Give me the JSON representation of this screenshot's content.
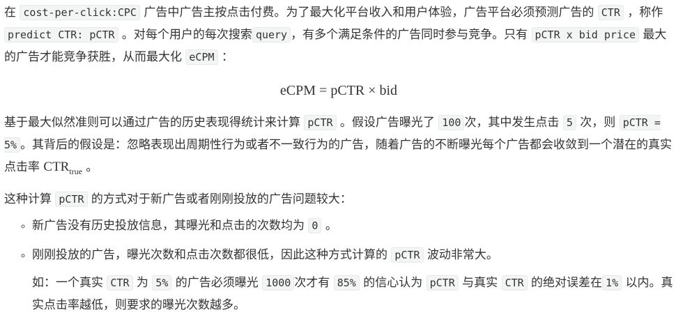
{
  "paragraphs": [
    {
      "id": "intro",
      "segments": [
        {
          "t": "在 "
        },
        {
          "c": "cost-per-click:CPC"
        },
        {
          "t": " 广告中广告主按点击付费。为了最大化平台收入和用户体验，广告平台必须预测广告的 "
        },
        {
          "c": "CTR"
        },
        {
          "t": " ，称作 "
        },
        {
          "c": "predict CTR: pCTR"
        },
        {
          "t": " 。对每个用户的每次搜索"
        },
        {
          "c": "query"
        },
        {
          "t": "，有多个满足条件的广告同时参与竞争。只有 "
        },
        {
          "c": "pCTR x bid price"
        },
        {
          "t": " 最大的广告才能竞争获胜，从而最大化 "
        },
        {
          "c": "eCPM"
        },
        {
          "t": " ："
        }
      ]
    },
    {
      "id": "estimate",
      "segments": [
        {
          "t": "基于最大似然准则可以通过广告的历史表现得统计来计算 "
        },
        {
          "c": "pCTR"
        },
        {
          "t": " 。假设广告曝光了 "
        },
        {
          "c": "100"
        },
        {
          "t": "次，其中发生点击 "
        },
        {
          "c": "5"
        },
        {
          "t": " 次，则 "
        },
        {
          "c": "pCTR = 5%"
        },
        {
          "t": "。其背后的假设是：忽略表现出周期性行为或者不一致行为的广告，随着广告的不断曝光每个广告都会收敛到一个潜在的真实点击率 "
        },
        {
          "m": "CTR",
          "sub": "true"
        },
        {
          "t": " 。"
        }
      ]
    },
    {
      "id": "problem",
      "segments": [
        {
          "t": "这种计算 "
        },
        {
          "c": "pCTR"
        },
        {
          "t": " 的方式对于新广告或者刚刚投放的广告问题较大："
        }
      ]
    }
  ],
  "formula": "eCPM = pCTR × bid",
  "list": [
    {
      "segments": [
        {
          "t": "新广告没有历史投放信息，其曝光和点击的次数均为 "
        },
        {
          "c": "0"
        },
        {
          "t": " 。"
        }
      ]
    },
    {
      "segments": [
        {
          "t": "刚刚投放的广告，曝光次数和点击次数都很低，因此这种方式计算的 "
        },
        {
          "c": "pCTR"
        },
        {
          "t": " 波动非常大。"
        }
      ]
    }
  ],
  "example": {
    "segments": [
      {
        "t": "如：一个真实 "
      },
      {
        "c": "CTR"
      },
      {
        "t": " 为 "
      },
      {
        "c": "5%"
      },
      {
        "t": " 的广告必须曝光 "
      },
      {
        "c": "1000"
      },
      {
        "t": "次才有 "
      },
      {
        "c": "85%"
      },
      {
        "t": " 的信心认为 "
      },
      {
        "c": "pCTR"
      },
      {
        "t": " 与真实 "
      },
      {
        "c": "CTR"
      },
      {
        "t": " 的绝对误差在"
      },
      {
        "c": "1%"
      },
      {
        "t": " 以内。真实点击率越低，则要求的曝光次数越多。"
      }
    ]
  }
}
